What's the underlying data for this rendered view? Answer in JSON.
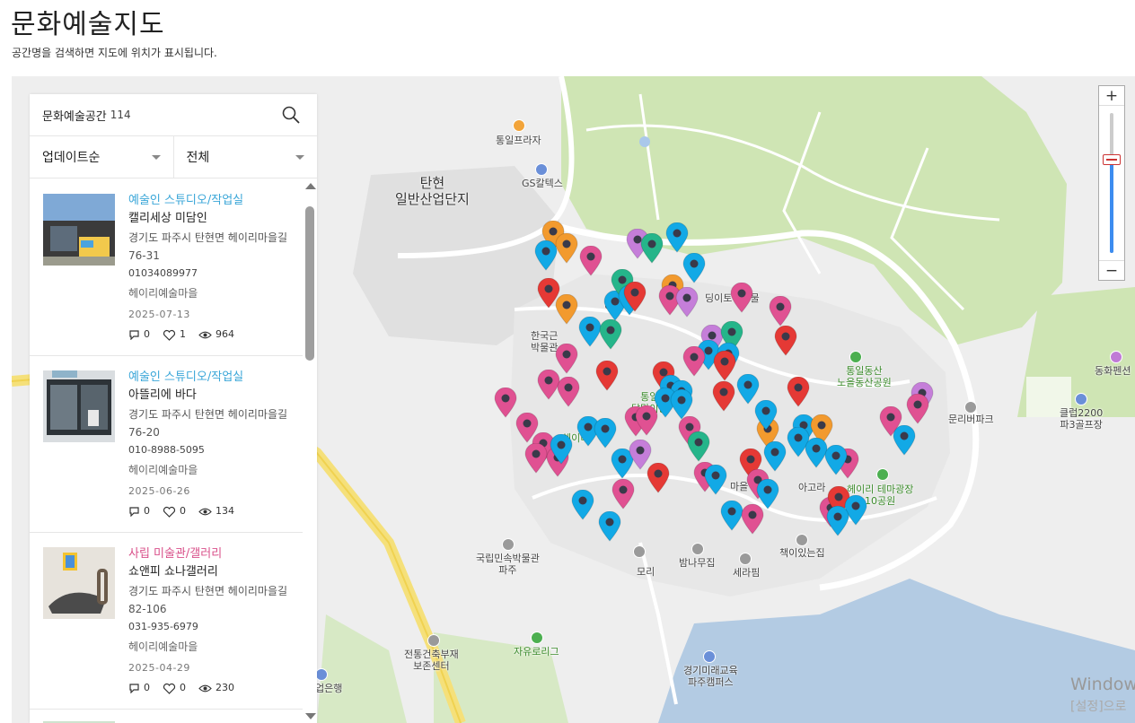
{
  "page": {
    "title": "문화예술지도",
    "subtitle": "공간명을 검색하면 지도에 위치가 표시됩니다."
  },
  "panel": {
    "search_title": "문화예술공간",
    "count": "114",
    "sort_label": "업데이트순",
    "filter_label": "전체",
    "items": [
      {
        "category": "예술인 스튜디오/작업실",
        "category_color": "#39a6d8",
        "name": "캘리세상 미담인",
        "address": "경기도 파주시 탄현면 헤이리마을길 76-31",
        "phone": "01034089977",
        "village": "헤이리예술마을",
        "date": "2025-07-13",
        "comments": "0",
        "likes": "1",
        "views": "964"
      },
      {
        "category": "예술인 스튜디오/작업실",
        "category_color": "#39a6d8",
        "name": "아뜰리에 바다",
        "address": "경기도 파주시 탄현면 헤이리마을길 76-20",
        "phone": "010-8988-5095",
        "village": "헤이리예술마을",
        "date": "2025-06-26",
        "comments": "0",
        "likes": "0",
        "views": "134"
      },
      {
        "category": "사립 미술관/갤러리",
        "category_color": "#d9508a",
        "name": "쇼앤피 쇼나갤러리",
        "address": "경기도 파주시 탄현면 헤이리마을길 82-106",
        "phone": "031-935-6979",
        "village": "헤이리예술마을",
        "date": "2025-04-29",
        "comments": "0",
        "likes": "0",
        "views": "230"
      }
    ]
  },
  "map": {
    "labels": {
      "tanhyeon": "탄현\n일반산업단지",
      "tongil_plaza": "통일프라자",
      "gs_caltex": "GS칼텍스",
      "korea_museum": "한국근\n박물관",
      "tongil_park": "통일동산\n노을동산공원",
      "moon_village": "통일\n달맞이동",
      "heyri": "헤이리",
      "moriverpark": "문리버파크",
      "club2200": "클럽2200\n파3골프장",
      "donghwa_pension": "동화펜션",
      "theme_park": "헤이리 테마광장\n10공원",
      "agora": "아고라",
      "national_folk": "국립민속박물관\n파주",
      "bamna": "밤나무집",
      "serapim": "세라핌",
      "book_house": "책이있는집",
      "mori": "모리",
      "traditional": "전통건축부재\n보존센터",
      "freedom_road": "자유로리그",
      "gyeonggi_edu": "경기미래교육\n파주캠퍼스",
      "ibk_bank": "업은행",
      "toy_museum": "딩이토이박물",
      "hanul": "하늘",
      "village_hall": "마을"
    },
    "watermark_line1": "Window",
    "watermark_line2": "[설정]으로"
  },
  "pin_colors": {
    "blue": "#12a9e6",
    "pink": "#e05192",
    "red": "#e53935",
    "orange": "#f29a2e",
    "teal": "#25b58a",
    "purple": "#c57ed9"
  },
  "icons": {
    "search": "search-icon",
    "comment": "comment-icon",
    "like": "heart-icon",
    "views": "eye-icon",
    "zoom_in": "plus-icon",
    "zoom_out": "minus-icon"
  },
  "zoom": {
    "plus": "+",
    "minus": "−",
    "level": 0.63
  }
}
